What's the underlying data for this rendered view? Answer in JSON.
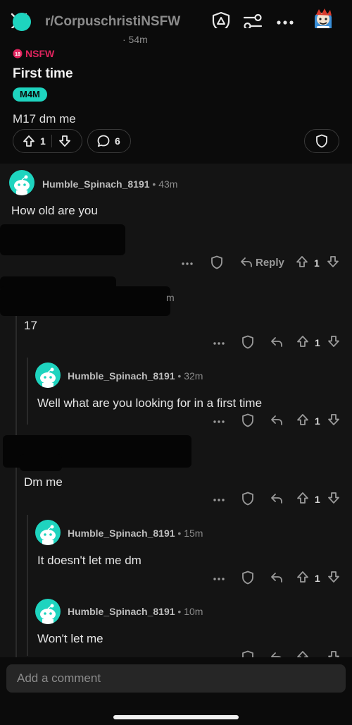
{
  "header": {
    "subreddit": "r/CorpuschristiNSFW",
    "icons": [
      "close-icon",
      "mod-shield-icon",
      "filter-icon",
      "more-icon",
      "avatar"
    ]
  },
  "post": {
    "author_time": "· 54m",
    "nsfw_label": "NSFW",
    "title": "First time",
    "flair": "M4M",
    "body": "M17 dm me",
    "votes": "1",
    "comments": "6"
  },
  "comments": [
    {
      "user": "Humble_Spinach_8191",
      "time": " • 43m",
      "text": "How old are you",
      "votes": "1",
      "reply_label": "Reply"
    },
    {
      "user": "",
      "time": "m",
      "text": "17",
      "votes": "1"
    },
    {
      "user": "Humble_Spinach_8191",
      "time": " • 32m",
      "text": "Well what are you looking for in a first time",
      "votes": "1"
    },
    {
      "user": "",
      "time": "",
      "text": "Dm me",
      "votes": "1"
    },
    {
      "user": "Humble_Spinach_8191",
      "time": " • 15m",
      "text": "It doesn't let me dm",
      "votes": "1"
    },
    {
      "user": "Humble_Spinach_8191",
      "time": " • 10m",
      "text": "Won't let me"
    }
  ],
  "composer": {
    "placeholder": "Add a comment"
  },
  "colors": {
    "accent": "#1ed4bf",
    "background": "#0b0b0b",
    "comments_bg": "#141414"
  }
}
